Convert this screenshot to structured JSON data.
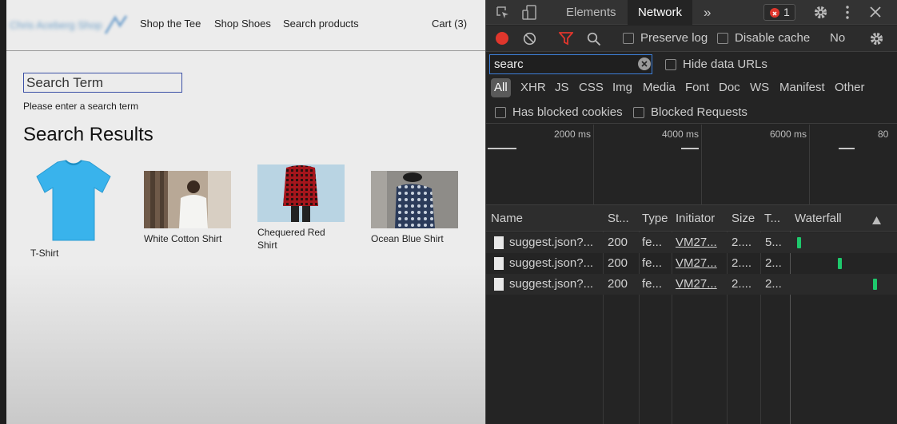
{
  "site": {
    "logo_text": "Chris Aceberg Shop",
    "nav": [
      "Shop the Tee",
      "Shop Shoes",
      "Search products"
    ],
    "cart": "Cart (3)",
    "search_placeholder": "Search Term",
    "search_hint": "Please enter a search term",
    "results_title": "Search Results",
    "products": [
      {
        "name": "T-Shirt",
        "icon": "tshirt-image"
      },
      {
        "name": "White Cotton Shirt",
        "icon": "white-shirt-photo"
      },
      {
        "name": "Chequered Red Shirt",
        "icon": "red-shirt-photo"
      },
      {
        "name": "Ocean Blue Shirt",
        "icon": "blue-shirt-photo"
      }
    ]
  },
  "devtools": {
    "tabs": [
      "Elements",
      "Network"
    ],
    "active_tab": "Network",
    "more_tabs_icon": "»",
    "error_count": "1",
    "toolbar": {
      "preserve_log": "Preserve log",
      "disable_cache": "Disable cache",
      "throttle": "No"
    },
    "filter_value": "searc",
    "hide_data_urls": "Hide data URLs",
    "types": [
      "All",
      "XHR",
      "JS",
      "CSS",
      "Img",
      "Media",
      "Font",
      "Doc",
      "WS",
      "Manifest",
      "Other"
    ],
    "has_blocked_cookies": "Has blocked cookies",
    "blocked_requests": "Blocked Requests",
    "timeline_labels": [
      "2000 ms",
      "4000 ms",
      "6000 ms",
      "80"
    ],
    "columns": [
      "Name",
      "St...",
      "Type",
      "Initiator",
      "Size",
      "T...",
      "Waterfall"
    ],
    "requests": [
      {
        "name": "suggest.json?...",
        "status": "200",
        "type": "fe...",
        "initiator": "VM27...",
        "size": "2....",
        "time": "5..."
      },
      {
        "name": "suggest.json?...",
        "status": "200",
        "type": "fe...",
        "initiator": "VM27...",
        "size": "2....",
        "time": "2..."
      },
      {
        "name": "suggest.json?...",
        "status": "200",
        "type": "fe...",
        "initiator": "VM27...",
        "size": "2....",
        "time": "2..."
      }
    ],
    "colors": {
      "accent_blue": "#3d7fd9",
      "record_red": "#e0362c",
      "waterfall_green": "#1ec86c"
    }
  }
}
